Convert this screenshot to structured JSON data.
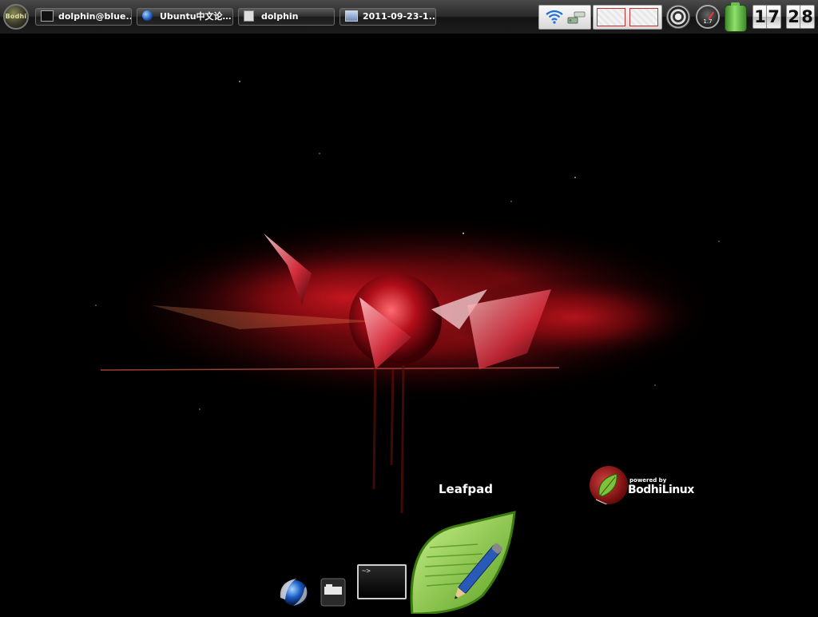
{
  "shelf": {
    "start_button": {
      "label": "Bodhi"
    },
    "tasks": [
      {
        "label": "dolphin@blue...",
        "icon": "terminal-icon"
      },
      {
        "label": "Ubuntu中文论…",
        "icon": "browser-globe-icon"
      },
      {
        "label": "dolphin",
        "icon": "file-manager-icon"
      },
      {
        "label": "2011-09-23-1...",
        "icon": "image-viewer-icon"
      }
    ],
    "tray": {
      "icons": [
        "wifi-icon",
        "network-connection-icon"
      ]
    },
    "pager": {
      "desktops": 2
    },
    "gadgets": {
      "volume": {
        "icon": "volume-knob-icon"
      },
      "cpu": {
        "label": "1.7",
        "icon": "cpu-gauge-icon"
      },
      "battery": {
        "icon": "battery-icon",
        "color": "#5cb83c"
      }
    },
    "clock": {
      "hour_tens": "1",
      "hour_ones": "7",
      "minute_tens": "2",
      "minute_ones": "8"
    }
  },
  "wallpaper": {
    "logo": {
      "powered_by": "powered by",
      "name": "BodhiLinux"
    },
    "accent_color": "#d0101a"
  },
  "dock": {
    "tooltip": "Leafpad",
    "items": [
      {
        "name": "browser",
        "icon": "browser-globe-icon"
      },
      {
        "name": "files",
        "icon": "file-manager-icon"
      },
      {
        "name": "terminal",
        "icon": "terminal-icon",
        "prompt": "~>"
      },
      {
        "name": "leafpad",
        "icon": "leafpad-leaf-pencil-icon"
      }
    ]
  }
}
